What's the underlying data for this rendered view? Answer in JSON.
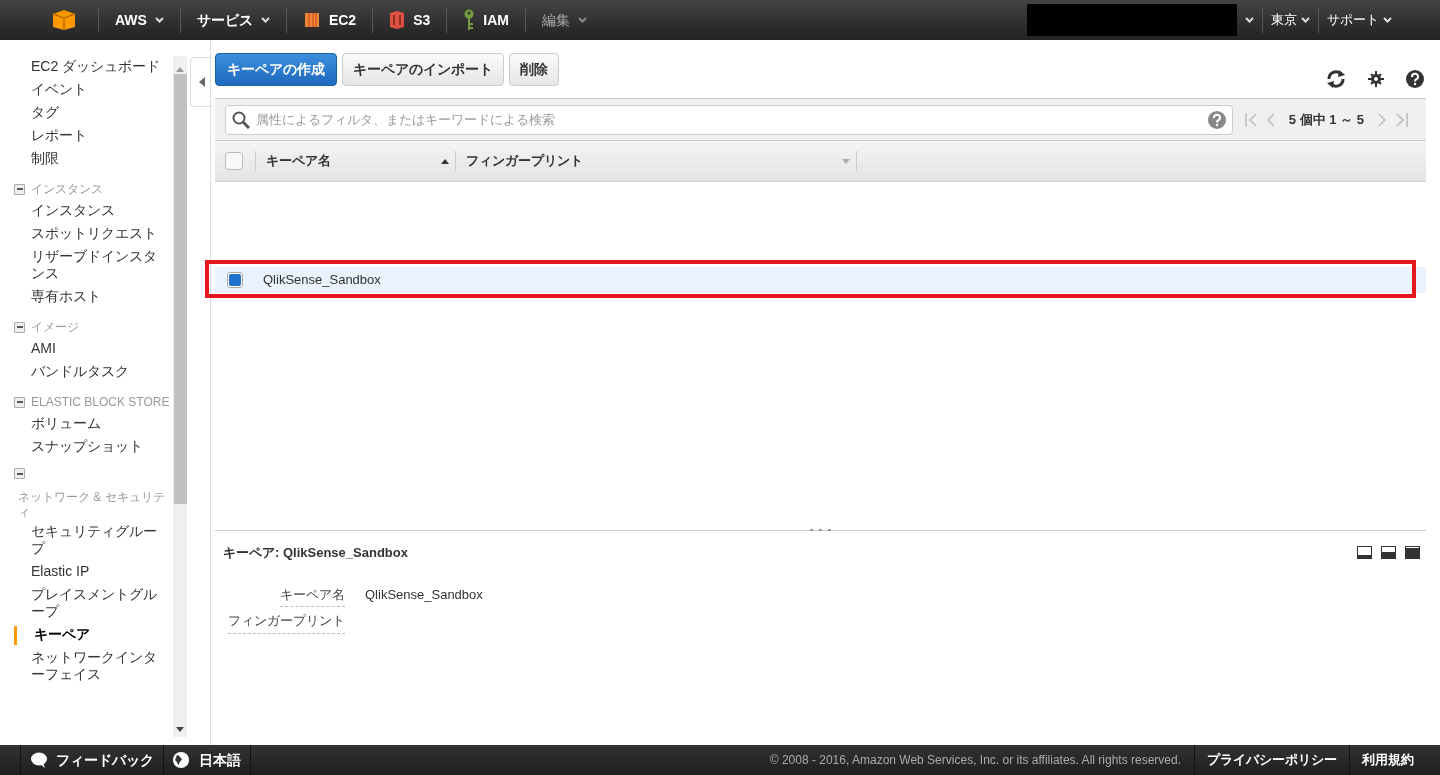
{
  "top_nav": {
    "items": [
      {
        "kind": "logo"
      },
      {
        "kind": "menu",
        "label": "AWS"
      },
      {
        "kind": "menu",
        "label": "サービス"
      },
      {
        "kind": "service",
        "label": "EC2"
      },
      {
        "kind": "service",
        "label": "S3"
      },
      {
        "kind": "service",
        "label": "IAM"
      },
      {
        "kind": "edit",
        "label": "編集"
      }
    ],
    "right": [
      {
        "kind": "redacted"
      },
      {
        "kind": "menu",
        "label": "東京"
      },
      {
        "kind": "menu",
        "label": "サポート"
      }
    ]
  },
  "sidebar": {
    "items": [
      {
        "kind": "link",
        "label": "EC2 ダッシュボード",
        "selected": false
      },
      {
        "kind": "link",
        "label": "イベント",
        "selected": false
      },
      {
        "kind": "link",
        "label": "タグ",
        "selected": false
      },
      {
        "kind": "link",
        "label": "レポート",
        "selected": false
      },
      {
        "kind": "link",
        "label": "制限",
        "selected": false
      },
      {
        "kind": "group",
        "label": "インスタンス",
        "expanded": true,
        "children": [
          {
            "label": "インスタンス",
            "selected": false
          },
          {
            "label": "スポットリクエスト",
            "selected": false
          },
          {
            "label": "リザーブドインスタンス",
            "selected": false
          },
          {
            "label": "専有ホスト",
            "selected": false
          }
        ]
      },
      {
        "kind": "group",
        "label": "イメージ",
        "expanded": true,
        "children": [
          {
            "label": "AMI",
            "selected": false
          },
          {
            "label": "バンドルタスク",
            "selected": false
          }
        ]
      },
      {
        "kind": "group",
        "label": "ELASTIC BLOCK STORE",
        "expanded": true,
        "children": [
          {
            "label": "ボリューム",
            "selected": false
          },
          {
            "label": "スナップショット",
            "selected": false
          }
        ]
      },
      {
        "kind": "group",
        "expanded": true,
        "caption": "ネットワーク & セキュリティ",
        "children": [
          {
            "label": "セキュリティグループ",
            "selected": false
          },
          {
            "label": "Elastic IP",
            "selected": false
          },
          {
            "label": "プレイスメントグループ",
            "selected": false
          },
          {
            "label": "キーペア",
            "selected": true
          },
          {
            "label": "ネットワークインターフェイス",
            "selected": false
          }
        ]
      }
    ]
  },
  "toolbar": {
    "buttons": [
      {
        "label": "キーペアの作成",
        "primary": true
      },
      {
        "label": "キーペアのインポート",
        "primary": false
      },
      {
        "label": "削除",
        "primary": false
      }
    ]
  },
  "filter": {
    "placeholder": "属性によるフィルタ、またはキーワードによる検索",
    "pagination": "5 個中 1 ～ 5"
  },
  "table": {
    "all_checked": false,
    "columns": [
      {
        "label": "キーペア名",
        "sorted": true
      },
      {
        "label": "フィンガープリント",
        "sorted": false
      }
    ],
    "rows": [
      {
        "cells": [
          "QlikSense_Sandbox"
        ],
        "selected": true,
        "highlighted": true
      }
    ]
  },
  "details": {
    "title": "キーペア: QlikSense_Sandbox",
    "fields": [
      {
        "label": "キーペア名",
        "value": "QlikSense_Sandbox"
      },
      {
        "label": "フィンガープリント"
      }
    ]
  },
  "footer": {
    "feedback": "フィードバック",
    "language": "日本語",
    "copyright": "© 2008 - 2016, Amazon Web Services, Inc. or its affiliates. All rights reserved.",
    "links": [
      "プライバシーポリシー",
      "利用規約"
    ]
  }
}
